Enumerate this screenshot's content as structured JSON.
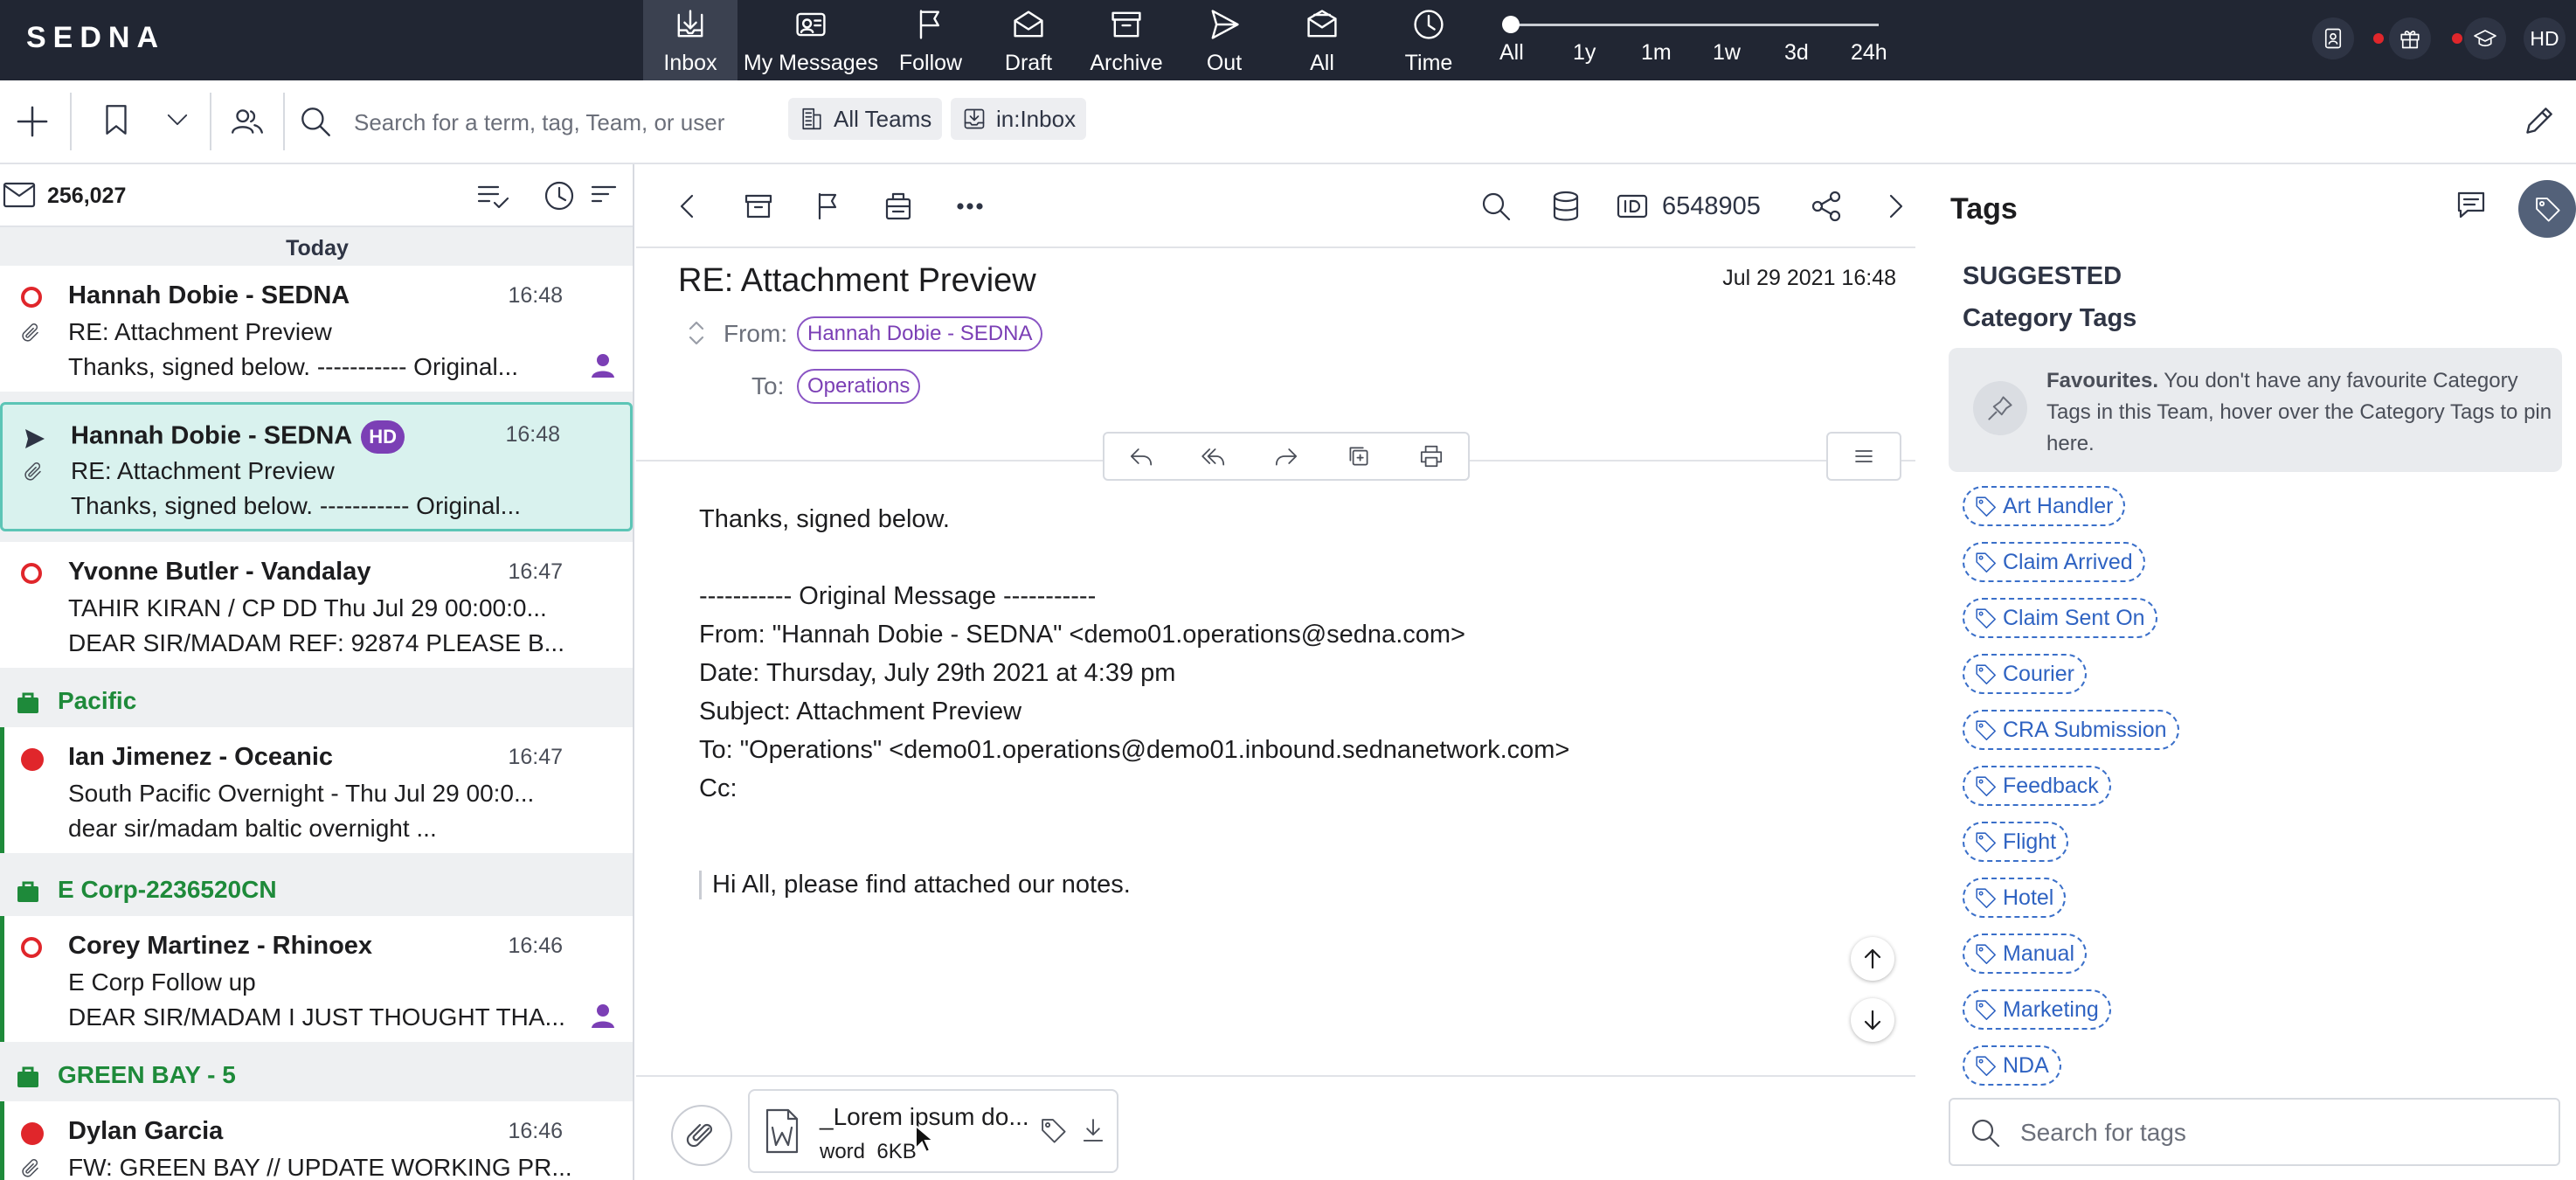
{
  "app": {
    "logo": "SEDNA"
  },
  "nav": [
    {
      "label": "Inbox"
    },
    {
      "label": "My Messages"
    },
    {
      "label": "Follow"
    },
    {
      "label": "Draft"
    },
    {
      "label": "Archive"
    },
    {
      "label": "Out"
    },
    {
      "label": "All"
    },
    {
      "label": "Time"
    }
  ],
  "range": [
    "All",
    "1y",
    "1m",
    "1w",
    "3d",
    "24h"
  ],
  "user": {
    "initials": "HD"
  },
  "search": {
    "placeholder": "Search for a term, tag, Team, or user"
  },
  "filters": {
    "teams": "All Teams",
    "scope": "in:Inbox"
  },
  "list": {
    "count": "256,027",
    "day": "Today",
    "items": [
      {
        "name": "Hannah Dobie - SEDNA",
        "time": "16:48",
        "subject": "RE: Attachment Preview",
        "preview": "Thanks, signed below. ----------- Original..."
      },
      {
        "name": "Hannah Dobie - SEDNA",
        "badge": "HD",
        "time": "16:48",
        "subject": "RE: Attachment Preview",
        "preview": "Thanks, signed below. ----------- Original..."
      },
      {
        "name": "Yvonne Butler - Vandalay",
        "time": "16:47",
        "subject": "TAHIR KIRAN / CP DD Thu Jul 29 00:00:0...",
        "preview": "DEAR SIR/MADAM REF: 92874 PLEASE B..."
      },
      {
        "group": "Pacific"
      },
      {
        "name": "Ian Jimenez - Oceanic",
        "time": "16:47",
        "subject": "South Pacific Overnight - Thu Jul 29 00:0...",
        "preview": "dear sir/madam baltic overnight ..."
      },
      {
        "group": "E Corp-2236520CN"
      },
      {
        "name": "Corey Martinez - Rhinoex",
        "time": "16:46",
        "subject": "E Corp Follow up",
        "preview": "DEAR SIR/MADAM I JUST THOUGHT THA..."
      },
      {
        "group": "GREEN BAY - 5"
      },
      {
        "name": "Dylan Garcia",
        "time": "16:46",
        "subject": "FW: GREEN BAY // UPDATE WORKING PR..."
      }
    ]
  },
  "message": {
    "id": "6548905",
    "subject": "RE: Attachment Preview",
    "date": "Jul 29 2021 16:48",
    "from_label": "From:",
    "from": "Hannah Dobie - SEDNA",
    "to_label": "To:",
    "to": "Operations",
    "body": [
      "Thanks, signed below.",
      "----------- Original Message -----------",
      "From: \"Hannah Dobie - SEDNA\" <demo01.operations@sedna.com>",
      "Date: Thursday, July 29th 2021 at 4:39 pm",
      "Subject: Attachment Preview",
      "To: \"Operations\" <demo01.operations@demo01.inbound.sednanetwork.com>",
      "Cc:"
    ],
    "quote": "Hi All, please find attached our notes.",
    "attachment": {
      "name": "_Lorem ipsum do...",
      "type": "word",
      "size": "6KB"
    }
  },
  "tags_panel": {
    "title": "Tags",
    "suggested": "SUGGESTED",
    "category": "Category Tags",
    "fav_bold": "Favourites.",
    "fav_text": " You don't have any favourite Category Tags in this Team, hover over the Category Tags to pin here.",
    "tags": [
      "Art Handler",
      "Claim Arrived",
      "Claim Sent On",
      "Courier",
      "CRA Submission",
      "Feedback",
      "Flight",
      "Hotel",
      "Manual",
      "Marketing",
      "NDA"
    ],
    "search_placeholder": "Search for tags"
  },
  "colors": {
    "topbar": "#212633",
    "accent_purple": "#7b3fb5",
    "group_green": "#1e8a3a",
    "tag_blue": "#2f63c2",
    "selected_bg": "#d9f2ee",
    "unread_red": "#e0262b"
  }
}
